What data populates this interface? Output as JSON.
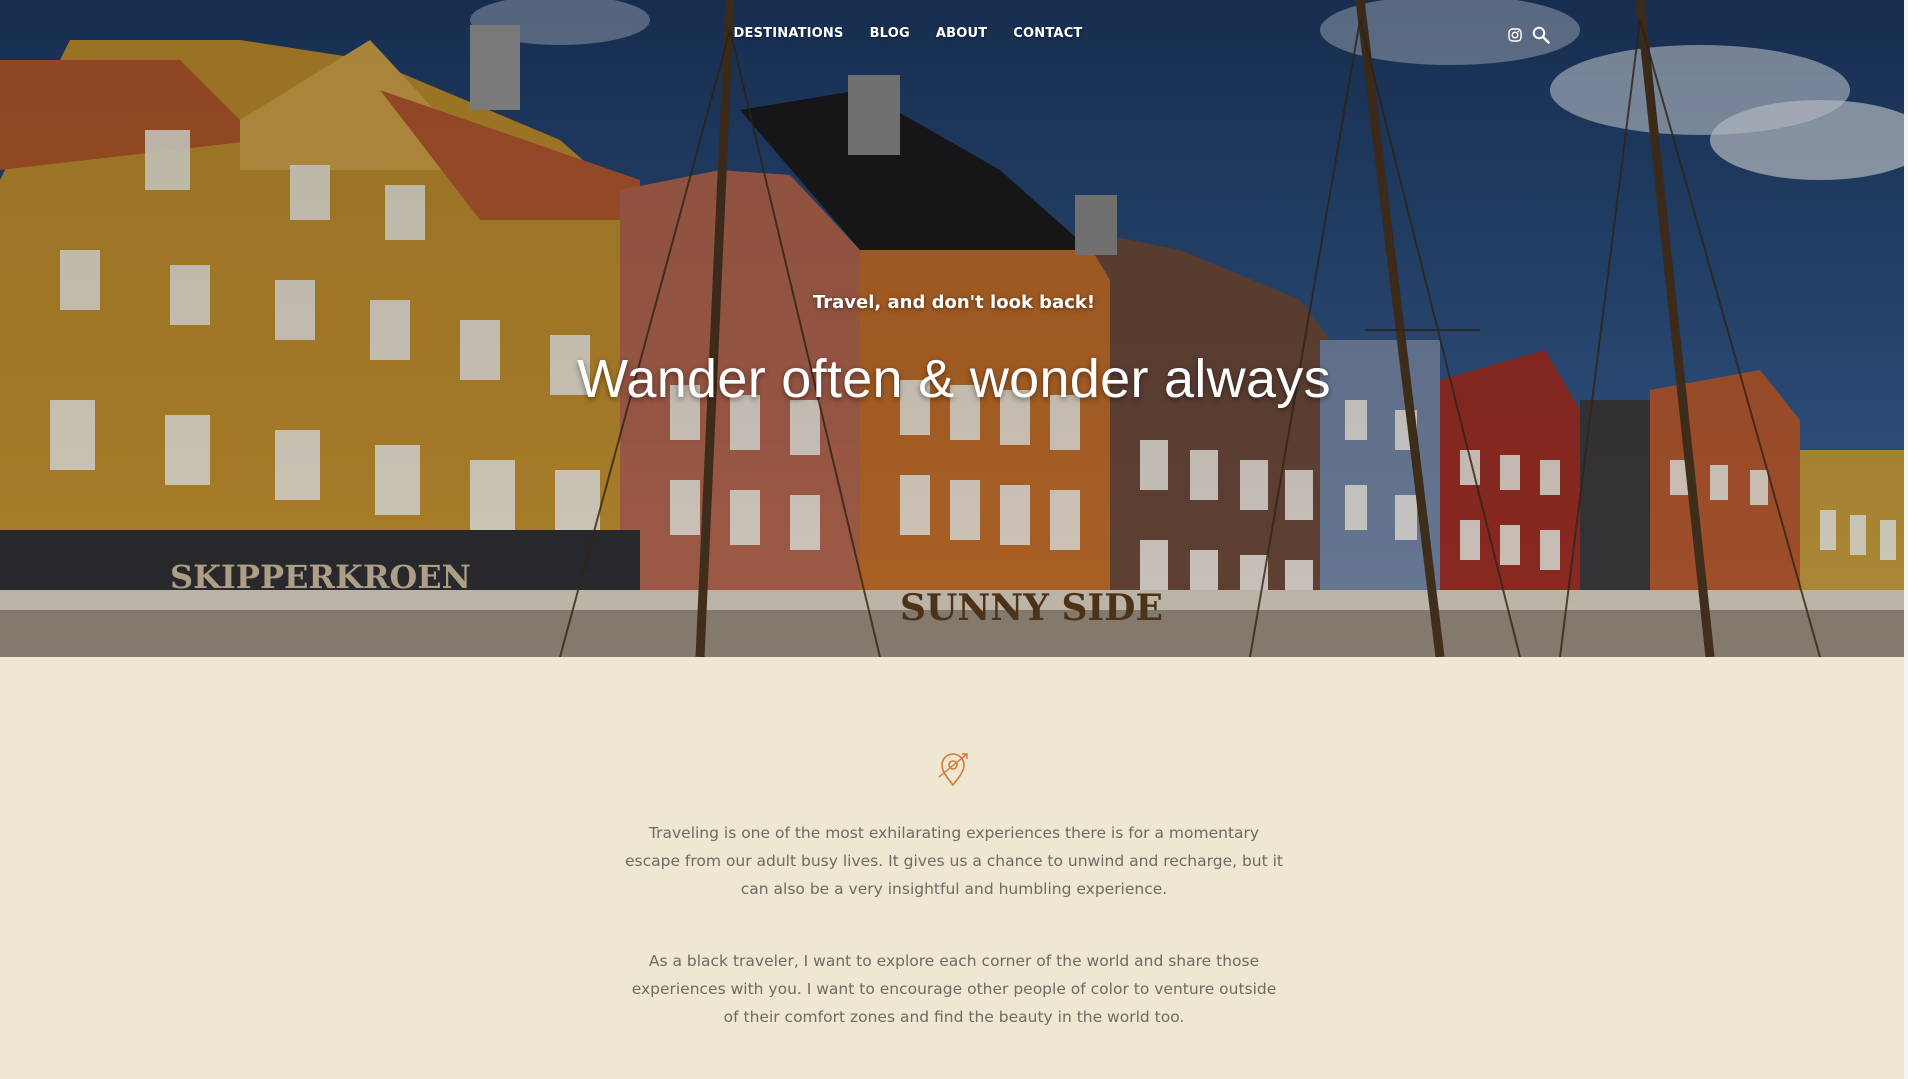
{
  "nav": {
    "items": [
      {
        "label": "DESTINATIONS"
      },
      {
        "label": "BLOG"
      },
      {
        "label": "ABOUT"
      },
      {
        "label": "CONTACT"
      }
    ]
  },
  "header_icons": [
    "instagram-icon",
    "search-icon"
  ],
  "hero": {
    "tagline": "Travel, and don't look back!",
    "headline": "Wander often & wonder always",
    "image_description_icon": "harbor-photo"
  },
  "intro": {
    "icon": "map-pin-icon",
    "paragraph_1": "Traveling is one of the most exhilarating experiences there is for a momentary escape from our adult busy lives. It gives us a chance to unwind and recharge, but it can also be a very insightful and humbling experience.",
    "paragraph_2": "As a black traveler, I want to explore each corner of the world and share those experiences with you. I want to encourage other people of color to venture outside of their comfort zones and find the beauty in the world too."
  },
  "colors": {
    "background": "#efe7d1",
    "body_text": "#6e6a64",
    "accent": "#d9773a",
    "nav_text": "#ffffff"
  }
}
